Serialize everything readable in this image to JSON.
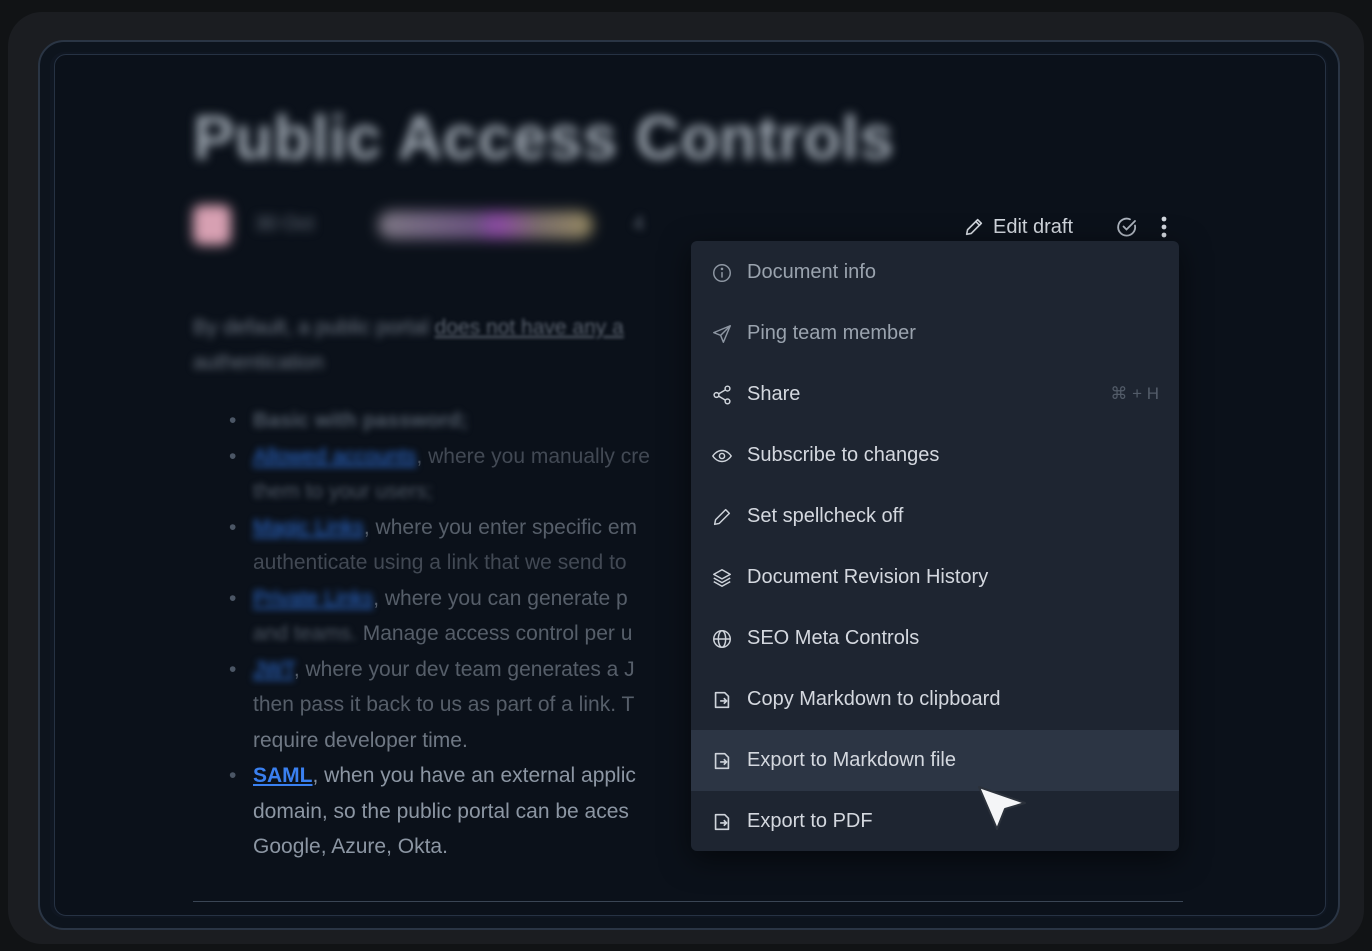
{
  "document": {
    "title": "Public Access Controls",
    "meta_date": "30 Oct",
    "meta_count": "4",
    "intro_blurred": "By default, a public portal",
    "intro_link": "does not have any a",
    "intro_line2": "authentication",
    "bullets": [
      {
        "lead": "Basic with password;",
        "text": ""
      },
      {
        "lead": "Allowed accounts",
        "text": ", where you manually cre",
        "cont_dim": "them to your users;"
      },
      {
        "lead": "Magic Links",
        "text": ", where you enter specific em",
        "cont": "authenticate using a link that we send to"
      },
      {
        "lead": "Private Links",
        "text": ", where you can generate p",
        "cont_prefix": "and teams.",
        "cont": " Manage access control per u"
      },
      {
        "lead": "JWT",
        "text": ", where your dev team generates a J",
        "cont": "then pass it back to us as part of a link. T",
        "cont2": "require developer time."
      },
      {
        "lead": "SAML",
        "text": ", when you have an external applic",
        "cont": "domain, so the public portal can be aces",
        "cont2": "Google, Azure, Okta."
      }
    ]
  },
  "toolbar": {
    "edit_draft_label": "Edit draft"
  },
  "menu": {
    "items": [
      {
        "label": "Document info",
        "icon": "info-circle-icon"
      },
      {
        "label": "Ping team member",
        "icon": "send-icon"
      },
      {
        "label": "Share",
        "icon": "share-icon",
        "shortcut": "⌘ + H"
      },
      {
        "label": "Subscribe to changes",
        "icon": "eye-icon"
      },
      {
        "label": "Set spellcheck off",
        "icon": "pencil-icon"
      },
      {
        "label": "Document Revision History",
        "icon": "layers-icon"
      },
      {
        "label": "SEO Meta Controls",
        "icon": "globe-icon"
      },
      {
        "label": "Copy Markdown to clipboard",
        "icon": "export-icon"
      },
      {
        "label": "Export to Markdown file",
        "icon": "export-icon",
        "hovered": true
      },
      {
        "label": "Export to PDF",
        "icon": "export-icon"
      }
    ]
  },
  "colors": {
    "background": "#0b111a",
    "menu_bg": "#1e2531",
    "menu_hover": "#2c3544",
    "link": "#3a80f0"
  }
}
